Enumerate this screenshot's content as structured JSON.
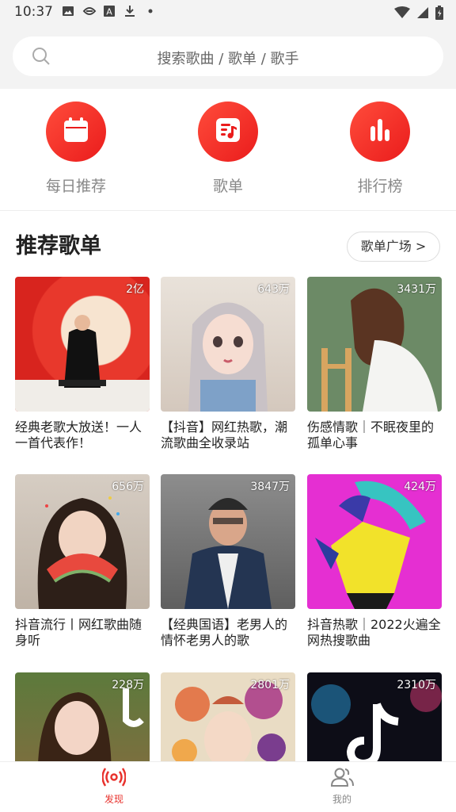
{
  "status_bar": {
    "time": "10:37"
  },
  "search": {
    "placeholder": "搜索歌曲 / 歌单 / 歌手"
  },
  "categories": [
    {
      "label": "每日推荐",
      "icon": "calendar-icon"
    },
    {
      "label": "歌单",
      "icon": "playlist-icon"
    },
    {
      "label": "排行榜",
      "icon": "chart-bars-icon"
    }
  ],
  "section": {
    "title": "推荐歌单",
    "plaza_label": "歌单广场 >"
  },
  "playlists": [
    {
      "count": "2亿",
      "title": "经典老歌大放送！一人一首代表作！"
    },
    {
      "count": "643万",
      "title": "【抖音】网红热歌，潮流歌曲全收录站"
    },
    {
      "count": "3431万",
      "title": "伤感情歌｜不眠夜里的孤单心事"
    },
    {
      "count": "656万",
      "title": "抖音流行丨网红歌曲随身听"
    },
    {
      "count": "3847万",
      "title": "【经典国语】老男人的情怀老男人的歌"
    },
    {
      "count": "424万",
      "title": "抖音热歌｜2022火遍全网热搜歌曲"
    },
    {
      "count": "228万",
      "title": ""
    },
    {
      "count": "2801万",
      "title": ""
    },
    {
      "count": "2310万",
      "title": ""
    }
  ],
  "nav": [
    {
      "label": "发现",
      "icon": "radio-broadcast-icon",
      "color": "#e8322d"
    },
    {
      "label": "我的",
      "icon": "users-icon",
      "color": "#888888"
    }
  ],
  "colors": {
    "accent": "#e8322d",
    "background": "#f3f3f3"
  }
}
